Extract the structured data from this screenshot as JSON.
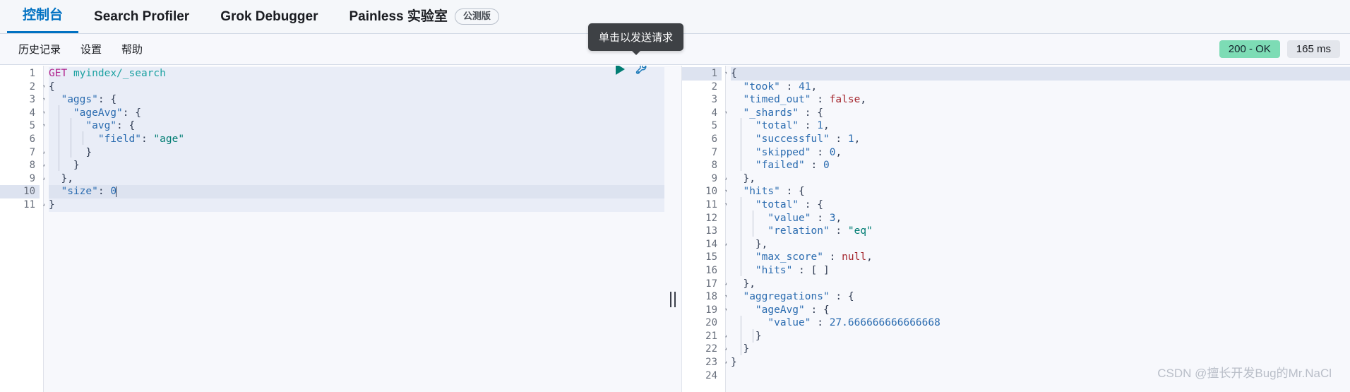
{
  "topnav": {
    "tabs": [
      {
        "label": "控制台",
        "active": true
      },
      {
        "label": "Search Profiler",
        "active": false
      },
      {
        "label": "Grok Debugger",
        "active": false
      },
      {
        "label": "Painless 实验室",
        "active": false,
        "badge": "公测版"
      }
    ]
  },
  "subnav": {
    "items": [
      {
        "label": "历史记录"
      },
      {
        "label": "设置"
      },
      {
        "label": "帮助"
      }
    ],
    "status_code": "200 - OK",
    "duration": "165 ms"
  },
  "tooltip": {
    "text": "单击以发送请求"
  },
  "request_editor": {
    "name": "console-request-editor",
    "lines": [
      {
        "n": "1",
        "fold": "",
        "active": false,
        "banded": true,
        "tokens": [
          {
            "t": "GET",
            "c": "t-method"
          },
          {
            "t": " ",
            "c": "t-punc"
          },
          {
            "t": "myindex/_search",
            "c": "t-path"
          }
        ]
      },
      {
        "n": "2",
        "fold": "▾",
        "active": false,
        "banded": true,
        "tokens": [
          {
            "t": "{",
            "c": "t-brace"
          }
        ]
      },
      {
        "n": "3",
        "fold": "▾",
        "active": false,
        "banded": true,
        "tokens": [
          {
            "t": "  ",
            "c": "t-punc"
          },
          {
            "t": "\"aggs\"",
            "c": "t-key"
          },
          {
            "t": ": {",
            "c": "t-punc"
          }
        ]
      },
      {
        "n": "4",
        "fold": "▾",
        "active": false,
        "banded": true,
        "tokens": [
          {
            "t": "    ",
            "c": "t-punc"
          },
          {
            "t": "\"ageAvg\"",
            "c": "t-key"
          },
          {
            "t": ": {",
            "c": "t-punc"
          }
        ]
      },
      {
        "n": "5",
        "fold": "▾",
        "active": false,
        "banded": true,
        "tokens": [
          {
            "t": "      ",
            "c": "t-punc"
          },
          {
            "t": "\"avg\"",
            "c": "t-key"
          },
          {
            "t": ": {",
            "c": "t-punc"
          }
        ]
      },
      {
        "n": "6",
        "fold": "",
        "active": false,
        "banded": true,
        "tokens": [
          {
            "t": "        ",
            "c": "t-punc"
          },
          {
            "t": "\"field\"",
            "c": "t-key"
          },
          {
            "t": ": ",
            "c": "t-punc"
          },
          {
            "t": "\"age\"",
            "c": "t-str"
          }
        ]
      },
      {
        "n": "7",
        "fold": "▴",
        "active": false,
        "banded": true,
        "tokens": [
          {
            "t": "      }",
            "c": "t-brace"
          }
        ]
      },
      {
        "n": "8",
        "fold": "▴",
        "active": false,
        "banded": true,
        "tokens": [
          {
            "t": "    }",
            "c": "t-brace"
          }
        ]
      },
      {
        "n": "9",
        "fold": "▴",
        "active": false,
        "banded": true,
        "tokens": [
          {
            "t": "  },",
            "c": "t-brace"
          }
        ]
      },
      {
        "n": "10",
        "fold": "",
        "active": true,
        "banded": true,
        "tokens": [
          {
            "t": "  ",
            "c": "t-punc"
          },
          {
            "t": "\"size\"",
            "c": "t-key"
          },
          {
            "t": ": ",
            "c": "t-punc"
          },
          {
            "t": "0",
            "c": "t-num"
          }
        ]
      },
      {
        "n": "11",
        "fold": "▴",
        "active": false,
        "banded": true,
        "tokens": [
          {
            "t": "}",
            "c": "t-brace"
          }
        ]
      }
    ]
  },
  "response_editor": {
    "name": "console-response-editor",
    "lines": [
      {
        "n": "1",
        "fold": "▾",
        "active": true,
        "tokens": [
          {
            "t": "{",
            "c": "t-brace"
          }
        ]
      },
      {
        "n": "2",
        "fold": "",
        "active": false,
        "tokens": [
          {
            "t": "  ",
            "c": "t-punc"
          },
          {
            "t": "\"took\"",
            "c": "t-key"
          },
          {
            "t": " : ",
            "c": "t-punc"
          },
          {
            "t": "41",
            "c": "t-num"
          },
          {
            "t": ",",
            "c": "t-punc"
          }
        ]
      },
      {
        "n": "3",
        "fold": "",
        "active": false,
        "tokens": [
          {
            "t": "  ",
            "c": "t-punc"
          },
          {
            "t": "\"timed_out\"",
            "c": "t-key"
          },
          {
            "t": " : ",
            "c": "t-punc"
          },
          {
            "t": "false",
            "c": "t-bool"
          },
          {
            "t": ",",
            "c": "t-punc"
          }
        ]
      },
      {
        "n": "4",
        "fold": "▾",
        "active": false,
        "tokens": [
          {
            "t": "  ",
            "c": "t-punc"
          },
          {
            "t": "\"_shards\"",
            "c": "t-key"
          },
          {
            "t": " : {",
            "c": "t-punc"
          }
        ]
      },
      {
        "n": "5",
        "fold": "",
        "active": false,
        "tokens": [
          {
            "t": "    ",
            "c": "t-punc"
          },
          {
            "t": "\"total\"",
            "c": "t-key"
          },
          {
            "t": " : ",
            "c": "t-punc"
          },
          {
            "t": "1",
            "c": "t-num"
          },
          {
            "t": ",",
            "c": "t-punc"
          }
        ]
      },
      {
        "n": "6",
        "fold": "",
        "active": false,
        "tokens": [
          {
            "t": "    ",
            "c": "t-punc"
          },
          {
            "t": "\"successful\"",
            "c": "t-key"
          },
          {
            "t": " : ",
            "c": "t-punc"
          },
          {
            "t": "1",
            "c": "t-num"
          },
          {
            "t": ",",
            "c": "t-punc"
          }
        ]
      },
      {
        "n": "7",
        "fold": "",
        "active": false,
        "tokens": [
          {
            "t": "    ",
            "c": "t-punc"
          },
          {
            "t": "\"skipped\"",
            "c": "t-key"
          },
          {
            "t": " : ",
            "c": "t-punc"
          },
          {
            "t": "0",
            "c": "t-num"
          },
          {
            "t": ",",
            "c": "t-punc"
          }
        ]
      },
      {
        "n": "8",
        "fold": "",
        "active": false,
        "tokens": [
          {
            "t": "    ",
            "c": "t-punc"
          },
          {
            "t": "\"failed\"",
            "c": "t-key"
          },
          {
            "t": " : ",
            "c": "t-punc"
          },
          {
            "t": "0",
            "c": "t-num"
          }
        ]
      },
      {
        "n": "9",
        "fold": "▴",
        "active": false,
        "tokens": [
          {
            "t": "  },",
            "c": "t-brace"
          }
        ]
      },
      {
        "n": "10",
        "fold": "▾",
        "active": false,
        "tokens": [
          {
            "t": "  ",
            "c": "t-punc"
          },
          {
            "t": "\"hits\"",
            "c": "t-key"
          },
          {
            "t": " : {",
            "c": "t-punc"
          }
        ]
      },
      {
        "n": "11",
        "fold": "▾",
        "active": false,
        "tokens": [
          {
            "t": "    ",
            "c": "t-punc"
          },
          {
            "t": "\"total\"",
            "c": "t-key"
          },
          {
            "t": " : {",
            "c": "t-punc"
          }
        ]
      },
      {
        "n": "12",
        "fold": "",
        "active": false,
        "tokens": [
          {
            "t": "      ",
            "c": "t-punc"
          },
          {
            "t": "\"value\"",
            "c": "t-key"
          },
          {
            "t": " : ",
            "c": "t-punc"
          },
          {
            "t": "3",
            "c": "t-num"
          },
          {
            "t": ",",
            "c": "t-punc"
          }
        ]
      },
      {
        "n": "13",
        "fold": "",
        "active": false,
        "tokens": [
          {
            "t": "      ",
            "c": "t-punc"
          },
          {
            "t": "\"relation\"",
            "c": "t-key"
          },
          {
            "t": " : ",
            "c": "t-punc"
          },
          {
            "t": "\"eq\"",
            "c": "t-str"
          }
        ]
      },
      {
        "n": "14",
        "fold": "▴",
        "active": false,
        "tokens": [
          {
            "t": "    },",
            "c": "t-brace"
          }
        ]
      },
      {
        "n": "15",
        "fold": "",
        "active": false,
        "tokens": [
          {
            "t": "    ",
            "c": "t-punc"
          },
          {
            "t": "\"max_score\"",
            "c": "t-key"
          },
          {
            "t": " : ",
            "c": "t-punc"
          },
          {
            "t": "null",
            "c": "t-null"
          },
          {
            "t": ",",
            "c": "t-punc"
          }
        ]
      },
      {
        "n": "16",
        "fold": "",
        "active": false,
        "tokens": [
          {
            "t": "    ",
            "c": "t-punc"
          },
          {
            "t": "\"hits\"",
            "c": "t-key"
          },
          {
            "t": " : [ ]",
            "c": "t-punc"
          }
        ]
      },
      {
        "n": "17",
        "fold": "▴",
        "active": false,
        "tokens": [
          {
            "t": "  },",
            "c": "t-brace"
          }
        ]
      },
      {
        "n": "18",
        "fold": "▾",
        "active": false,
        "tokens": [
          {
            "t": "  ",
            "c": "t-punc"
          },
          {
            "t": "\"aggregations\"",
            "c": "t-key"
          },
          {
            "t": " : {",
            "c": "t-punc"
          }
        ]
      },
      {
        "n": "19",
        "fold": "▾",
        "active": false,
        "tokens": [
          {
            "t": "    ",
            "c": "t-punc"
          },
          {
            "t": "\"ageAvg\"",
            "c": "t-key"
          },
          {
            "t": " : {",
            "c": "t-punc"
          }
        ]
      },
      {
        "n": "20",
        "fold": "",
        "active": false,
        "tokens": [
          {
            "t": "      ",
            "c": "t-punc"
          },
          {
            "t": "\"value\"",
            "c": "t-key"
          },
          {
            "t": " : ",
            "c": "t-punc"
          },
          {
            "t": "27.666666666666668",
            "c": "t-num"
          }
        ]
      },
      {
        "n": "21",
        "fold": "▴",
        "active": false,
        "tokens": [
          {
            "t": "    }",
            "c": "t-brace"
          }
        ]
      },
      {
        "n": "22",
        "fold": "▴",
        "active": false,
        "tokens": [
          {
            "t": "  }",
            "c": "t-brace"
          }
        ]
      },
      {
        "n": "23",
        "fold": "▴",
        "active": false,
        "tokens": [
          {
            "t": "}",
            "c": "t-brace"
          }
        ]
      },
      {
        "n": "24",
        "fold": "",
        "active": false,
        "tokens": []
      }
    ]
  },
  "actions": {
    "play_icon": "play-icon",
    "wrench_icon": "wrench-icon"
  },
  "watermark": {
    "text": "CSDN @擅长开发Bug的Mr.NaCl"
  },
  "colors": {
    "accent": "#0071c2",
    "success_badge": "#7ddcb5",
    "tooltip_bg": "#3e4145",
    "play": "#017d73"
  }
}
